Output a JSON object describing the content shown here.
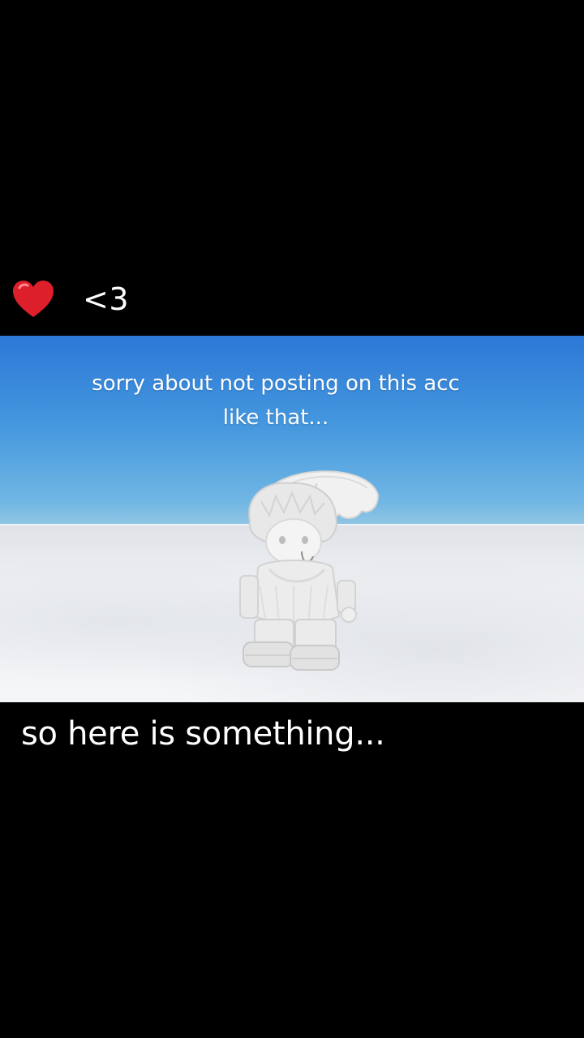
{
  "top_caption": {
    "emoji_icon": "red-heart-icon",
    "text": "<3"
  },
  "scene": {
    "overlay_text_line1": "sorry about not posting on this acc",
    "overlay_text_line2": "like that...",
    "sky_color": "#2c78d7",
    "ground_color": "#eef0f3"
  },
  "bottom_caption": {
    "text": "so here is something..."
  }
}
